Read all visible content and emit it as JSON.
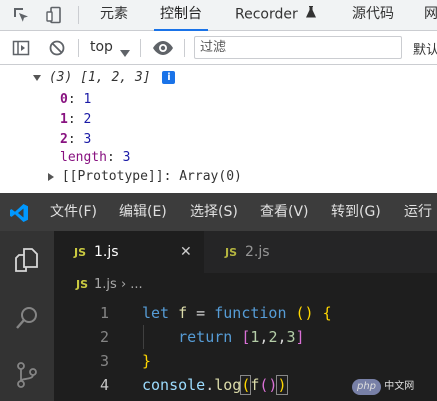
{
  "devtools": {
    "tabs": [
      {
        "label": "元素"
      },
      {
        "label": "控制台",
        "active": true
      },
      {
        "label": "Recorder"
      },
      {
        "label": "源代码"
      },
      {
        "label": "网"
      }
    ],
    "toolbar": {
      "context": "top",
      "filter_placeholder": "过滤",
      "levels": "默认"
    },
    "console": {
      "array_preview": "(3) [1, 2, 3]",
      "info_badge": "i",
      "entries": [
        {
          "key": "0",
          "value": "1"
        },
        {
          "key": "1",
          "value": "2"
        },
        {
          "key": "2",
          "value": "3"
        }
      ],
      "length_key": "length",
      "length_value": "3",
      "prototype": "[[Prototype]]: Array(0)"
    }
  },
  "vscode": {
    "menu": [
      "文件(F)",
      "编辑(E)",
      "选择(S)",
      "查看(V)",
      "转到(G)",
      "运行"
    ],
    "tabs": [
      {
        "badge": "JS",
        "label": "1.js",
        "close": "✕",
        "active": true
      },
      {
        "badge": "JS",
        "label": "2.js",
        "active": false
      }
    ],
    "breadcrumb": {
      "badge": "JS",
      "file": "1.js",
      "rest": "› ..."
    },
    "line_numbers": [
      "1",
      "2",
      "3",
      "4"
    ],
    "current_line": "4"
  },
  "watermark": {
    "logo": "php",
    "text": "中文网"
  },
  "colors": {
    "devtools_accent": "#1a73e8",
    "vscode_bg": "#1e1e1e",
    "vscode_titlebar": "#3c3c3c",
    "vscode_activitybar": "#333333",
    "vscode_accent": "#007acc"
  },
  "icons": [
    "inspect-icon",
    "device-icon",
    "recorder-flask-icon",
    "more-icon",
    "sidebar-toggle-icon",
    "clear-console-icon",
    "eye-icon",
    "vscode-logo-icon",
    "explorer-icon",
    "search-icon",
    "source-control-icon"
  ]
}
